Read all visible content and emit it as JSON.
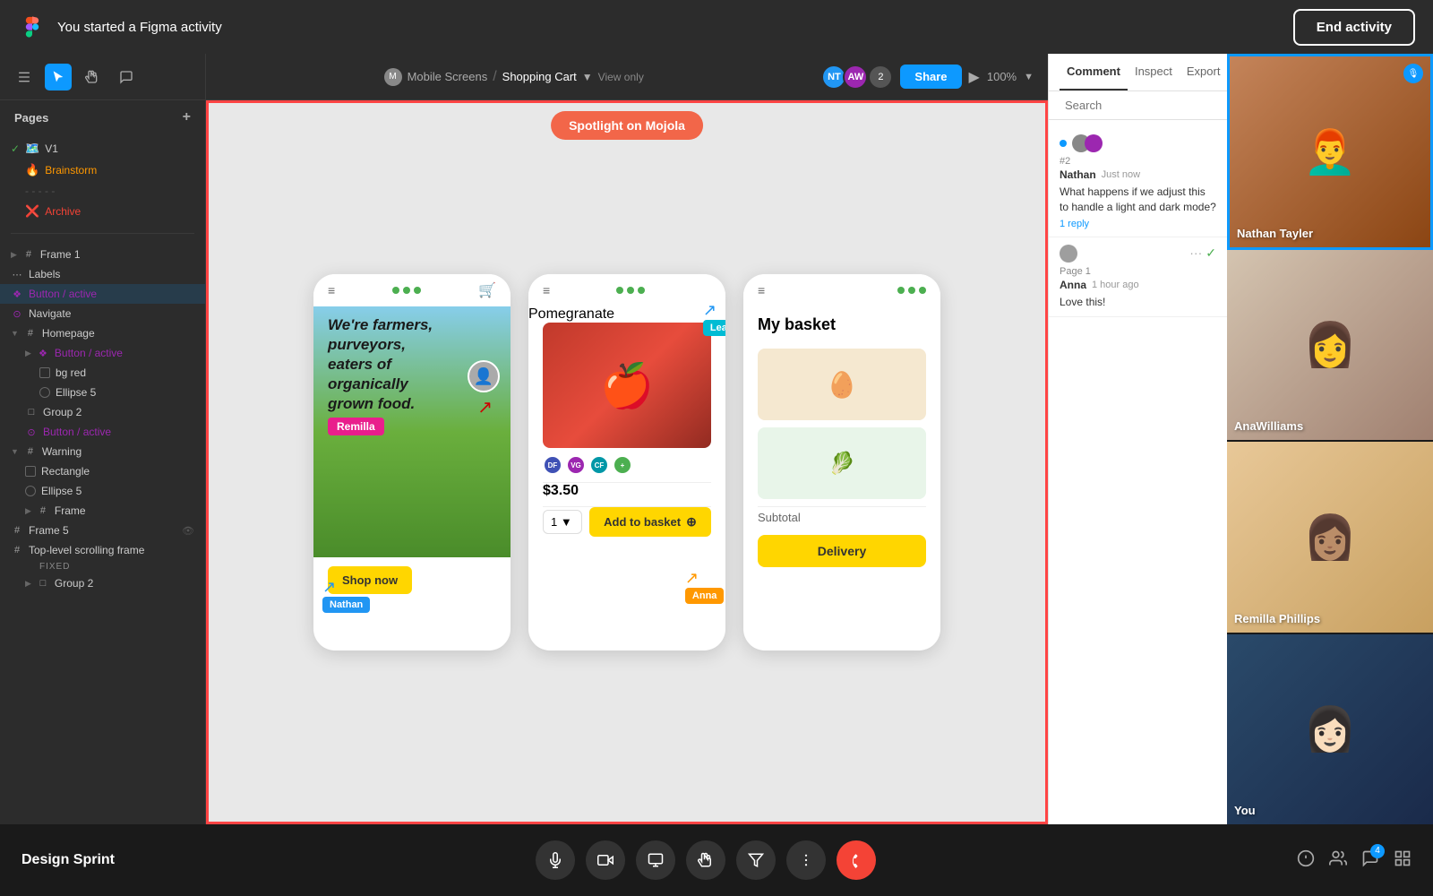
{
  "topbar": {
    "activity_text": "You started a Figma activity",
    "end_activity_label": "End activity"
  },
  "figma_nav": {
    "breadcrumb_parent": "Mobile Screens",
    "breadcrumb_separator": "/",
    "breadcrumb_current": "Shopping Cart",
    "view_mode": "View only",
    "zoom": "100%",
    "share_label": "Share",
    "avatar_count": "2"
  },
  "spotlight": {
    "label": "Spotlight on Mojola"
  },
  "pages": {
    "header": "Pages",
    "items": [
      {
        "label": "V1",
        "prefix": "🗺️",
        "indent": 0,
        "checked": true
      },
      {
        "label": "Brainstorm",
        "prefix": "🔥",
        "indent": 1
      },
      {
        "label": "-----",
        "indent": 1
      },
      {
        "label": "Archive",
        "prefix": "❌",
        "indent": 1
      }
    ]
  },
  "layers": {
    "items": [
      {
        "label": "Frame 1",
        "type": "frame",
        "indent": 0
      },
      {
        "label": "Labels",
        "type": "group-dashed",
        "indent": 0
      },
      {
        "label": "Button / active",
        "type": "component",
        "indent": 0,
        "selected": true
      },
      {
        "label": "Navigate",
        "type": "component-outline",
        "indent": 0
      },
      {
        "label": "Homepage",
        "type": "frame",
        "indent": 0,
        "expanded": true
      },
      {
        "label": "Button / active",
        "type": "component",
        "indent": 1,
        "expanded": true
      },
      {
        "label": "bg red",
        "type": "checkbox",
        "indent": 2
      },
      {
        "label": "Ellipse 5",
        "type": "circle",
        "indent": 2
      },
      {
        "label": "Group 2",
        "type": "group",
        "indent": 1
      },
      {
        "label": "Button / active",
        "type": "component",
        "indent": 1
      },
      {
        "label": "Warning",
        "type": "frame",
        "indent": 0,
        "expanded": true
      },
      {
        "label": "Rectangle",
        "type": "checkbox",
        "indent": 1
      },
      {
        "label": "Ellipse 5",
        "type": "circle",
        "indent": 1
      },
      {
        "label": "Frame",
        "type": "frame-expand",
        "indent": 1
      },
      {
        "label": "Frame 5",
        "type": "frame",
        "indent": 0,
        "eye": true
      },
      {
        "label": "Top-level scrolling frame",
        "type": "frame",
        "indent": 0
      },
      {
        "label": "FIXED",
        "type": "label"
      },
      {
        "label": "Group 2",
        "type": "group-expand",
        "indent": 1
      }
    ]
  },
  "screens": {
    "screen1": {
      "farm_text": "We're farmers, purveyors, eaters of organically grown food.",
      "remilla_tag": "Remilla",
      "shop_btn": "Shop now",
      "cursor_user": "Nathan"
    },
    "screen2": {
      "title": "Pomegranate",
      "price": "$3.50",
      "add_btn": "Add to basket",
      "qty": "1"
    },
    "screen3": {
      "title": "My basket",
      "subtotal": "Subtotal",
      "delivery_btn": "Delivery"
    }
  },
  "cursors": {
    "leandro": "Leandro",
    "anna": "Anna",
    "nathan": "Nathan"
  },
  "comments": {
    "tabs": [
      "Comment",
      "Inspect",
      "Export"
    ],
    "active_tab": "Comment",
    "search_placeholder": "Search",
    "items": [
      {
        "num": "#2",
        "author": "Nathan",
        "time": "Just now",
        "text": "What happens if we adjust this to handle a light and dark mode?",
        "replies": "1 reply"
      },
      {
        "page": "Page 1",
        "author": "Anna",
        "time": "1 hour ago",
        "text": "Love this!"
      }
    ]
  },
  "video_participants": [
    {
      "name": "Nathan Tayler",
      "active": true
    },
    {
      "name": "AnaWilliams"
    },
    {
      "name": "Remilla Phillips"
    },
    {
      "name": "You"
    }
  ],
  "bottom_bar": {
    "session_name": "Design Sprint",
    "controls": [
      "mic",
      "camera",
      "screen-share-icon",
      "hand-raise",
      "present",
      "more"
    ],
    "right_icons": [
      "info",
      "people",
      "chat",
      "grid"
    ]
  }
}
